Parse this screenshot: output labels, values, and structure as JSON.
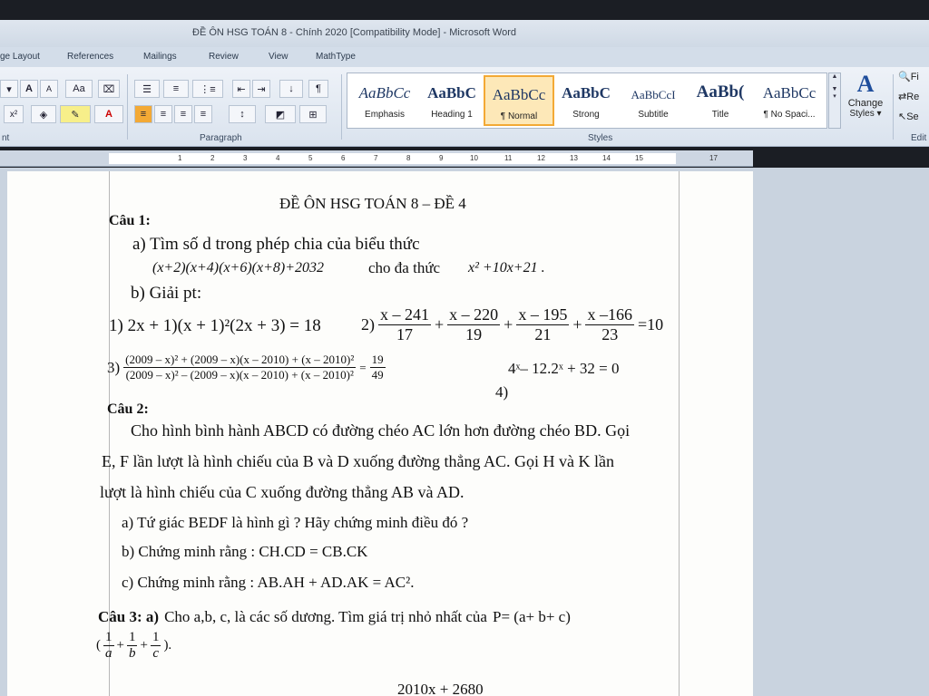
{
  "window": {
    "title": "ĐỀ ÔN HSG TOÁN 8 - Chính 2020 [Compatibility Mode] - Microsoft Word"
  },
  "tabs": [
    "ge Layout",
    "References",
    "Mailings",
    "Review",
    "View",
    "MathType"
  ],
  "groups": {
    "font_partial": "nt",
    "paragraph": "Paragraph",
    "styles": "Styles",
    "editing_partial": "Edit"
  },
  "font_buttons": {
    "grow": "A",
    "shrink": "A",
    "case": "Aa",
    "superscript": "x²",
    "color": "A"
  },
  "styles_gallery": [
    {
      "preview": "AaBbCc",
      "name": "Emphasis",
      "active": false
    },
    {
      "preview": "AaBbC",
      "name": "Heading 1",
      "active": false
    },
    {
      "preview": "AaBbCc",
      "name": "¶ Normal",
      "active": true
    },
    {
      "preview": "AaBbC",
      "name": "Strong",
      "active": false
    },
    {
      "preview": "AaBbCcI",
      "name": "Subtitle",
      "active": false
    },
    {
      "preview": "AaBb(",
      "name": "Title",
      "active": false
    },
    {
      "preview": "AaBbCc",
      "name": "¶ No Spaci...",
      "active": false
    }
  ],
  "change_styles": {
    "line1": "Change",
    "line2": "Styles ▾"
  },
  "editing": {
    "find": "Fi",
    "replace": "Re",
    "select": "Se"
  },
  "ruler_ticks": [
    "1",
    "2",
    "3",
    "4",
    "5",
    "6",
    "7",
    "8",
    "9",
    "10",
    "11",
    "12",
    "13",
    "14",
    "15",
    "17"
  ],
  "document": {
    "heading": "ĐỀ ÔN HSG TOÁN 8 – ĐỀ 4",
    "cau1": "Câu 1:",
    "cau1_a": "a) Tìm số d trong phép chia của biểu thức",
    "cau1_a_expr": "(x+2)(x+4)(x+6)(x+8)+2032",
    "cau1_a_for": "cho đa thức",
    "cau1_a_poly": "x² +10x+21 .",
    "cau1_b": "b) Giải pt:",
    "eq1": "1) 2x + 1)(x + 1)²(2x + 3) = 18",
    "eq2_label": "2)",
    "eq2_fracs": [
      {
        "num": "x – 241",
        "den": "17"
      },
      {
        "num": "x – 220",
        "den": "19"
      },
      {
        "num": "x – 195",
        "den": "21"
      },
      {
        "num": "x –166",
        "den": "23"
      }
    ],
    "eq2_rhs": "=10",
    "eq3_label": "3)",
    "eq3_num": "(2009 – x)² + (2009 – x)(x – 2010) + (x – 2010)²",
    "eq3_den": "(2009 – x)² – (2009 – x)(x – 2010) + (x – 2010)²",
    "eq3_rhs_num": "19",
    "eq3_rhs_den": "49",
    "eq4": "4ˣ– 12.2ˣ + 32 = 0",
    "eq4_label": "4)",
    "cau2": "Câu 2:",
    "cau2_p1": "Cho hình bình hành ABCD có đường chéo AC lớn hơn đường chéo BD. Gọi",
    "cau2_p2": "E, F lần lượt là hình chiếu của B và D xuống đường thẳng AC. Gọi H và K lần",
    "cau2_p3": "lượt là hình chiếu của C xuống đường thẳng AB và AD.",
    "cau2_a": "a)  Tứ giác BEDF là hình gì ? Hãy chứng minh điều đó ?",
    "cau2_b": "b)  Chứng minh rằng : CH.CD = CB.CK",
    "cau2_c": "c)  Chứng minh rằng : AB.AH + AD.AK = AC².",
    "cau3_label": "Câu 3: a)",
    "cau3_text": "Cho a,b, c, là các số dương. Tìm giá trị nhỏ nhất của",
    "cau3_P": "P= (a+ b+ c)",
    "cau3_f1n": "1",
    "cau3_f1d": "a",
    "cau3_f2n": "1",
    "cau3_f2d": "b",
    "cau3_f3n": "1",
    "cau3_f3d": "c",
    "cau3_end": ").",
    "bottom_partial": "2010x + 2680"
  }
}
